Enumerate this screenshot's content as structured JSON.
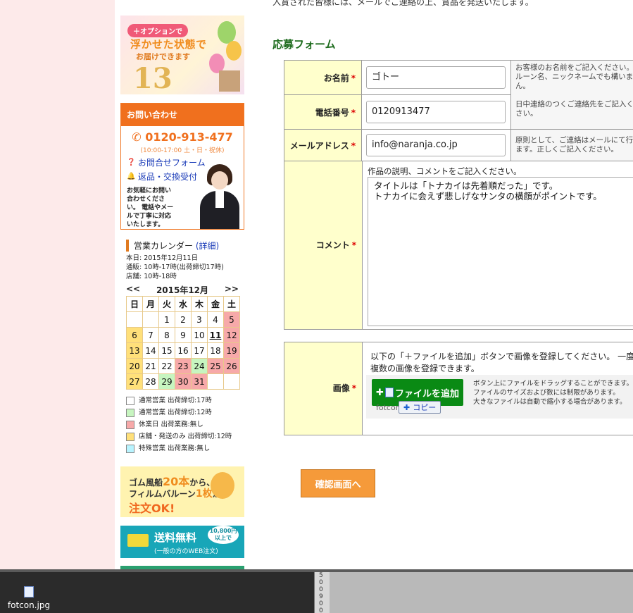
{
  "top_text": "入賞された皆様には、メールでご連絡の上、賞品を発送いたします。",
  "form": {
    "title": "応募フォーム",
    "required_mark": "*",
    "name": {
      "label": "お名前",
      "value": "ゴトー",
      "help": "お客様のお名前をご記入ください。バルーン名、ニックネームでも構いません。"
    },
    "phone": {
      "label": "電話番号",
      "value": "0120913477",
      "help": "日中連絡のつくご連絡先をご記入ください。"
    },
    "email": {
      "label": "メールアドレス",
      "value": "info@naranja.co.jp",
      "help": "原則として、ご連絡はメールにて行います。正しくご記入ください。"
    },
    "comment": {
      "label": "コメント",
      "hint": "作品の説明、コメントをご記入ください。",
      "value": "タイトルは「トナカイは先着順だった」です。\nトナカイに会えず悲しげなサンタの横顔がポイントです。"
    },
    "image": {
      "label": "画像",
      "description": "以下の「＋ファイルを追加」ボタンで画像を登録してください。 一度に複数の画像を登録できます。",
      "add_button": "ファイルを追加",
      "drop_note": "ボタン上にファイルをドラッグすることができます。\nファイルのサイズおよび数には制限があります。\n大きなファイルは自動で縮小する場合があります。",
      "drag_ghost": "fotcon",
      "copy_badge": "コピー"
    },
    "confirm_button": "確認画面へ"
  },
  "sidebar": {
    "balloon_banner": {
      "pill": "＋オプションで",
      "line1": "浮かせた状態で",
      "line2": "お届けできます",
      "number": "13"
    },
    "contact": {
      "title": "お問い合わせ",
      "phone": "0120-913-477",
      "hours": "(10:00-17:00 土・日・祝休)",
      "link_form": "お問合せフォーム",
      "link_return": "返品・交換受付",
      "note": "お気軽にお問い合わせください。 電話やメールで丁寧に対応いたします。"
    },
    "calendar": {
      "title": "営業カレンダー",
      "detail_link": "(詳細)",
      "today": "本日: 2015年12月11日",
      "hours1": "通販: 10時-17時(出荷締切17時)",
      "hours2": "店舗: 10時-18時",
      "prev": "<<",
      "month": "2015年12月",
      "next": ">>",
      "weekdays": [
        "日",
        "月",
        "火",
        "水",
        "木",
        "金",
        "土"
      ],
      "weeks": [
        [
          "",
          "",
          "1",
          "2",
          "3",
          "4",
          "5"
        ],
        [
          "6",
          "7",
          "8",
          "9",
          "10",
          "11",
          "12"
        ],
        [
          "13",
          "14",
          "15",
          "16",
          "17",
          "18",
          "19"
        ],
        [
          "20",
          "21",
          "22",
          "23",
          "24",
          "25",
          "26"
        ],
        [
          "27",
          "28",
          "29",
          "30",
          "31",
          "",
          ""
        ]
      ],
      "legend": [
        {
          "label": "通常営業 出荷締切:17時",
          "color": "#ffffff"
        },
        {
          "label": "通常営業 出荷締切:12時",
          "color": "#c7f5c0"
        },
        {
          "label": "休業日 出荷業務:無し",
          "color": "#f7a9a9"
        },
        {
          "label": "店舗・発送のみ 出荷締切:12時",
          "color": "#ffe07a"
        },
        {
          "label": "特殊営業 出荷業務:無し",
          "color": "#b8f4ff"
        }
      ]
    },
    "gum_banner": {
      "line1_pre": "ゴム風船",
      "line1_num": "20本",
      "line1_post": "から、",
      "line2_pre": "フィルムバルーン",
      "line2_num": "1枚",
      "line2_post": "から",
      "line3": "注文OK!"
    },
    "ship_banner": {
      "title": "送料無料",
      "sub": "(一般の方のWEB注文)",
      "badge": "10,800円以上で"
    }
  },
  "taskbar": {
    "file_name": "fotcon.jpg",
    "ruler": "5\n0\n0\n9\n0\n0"
  }
}
